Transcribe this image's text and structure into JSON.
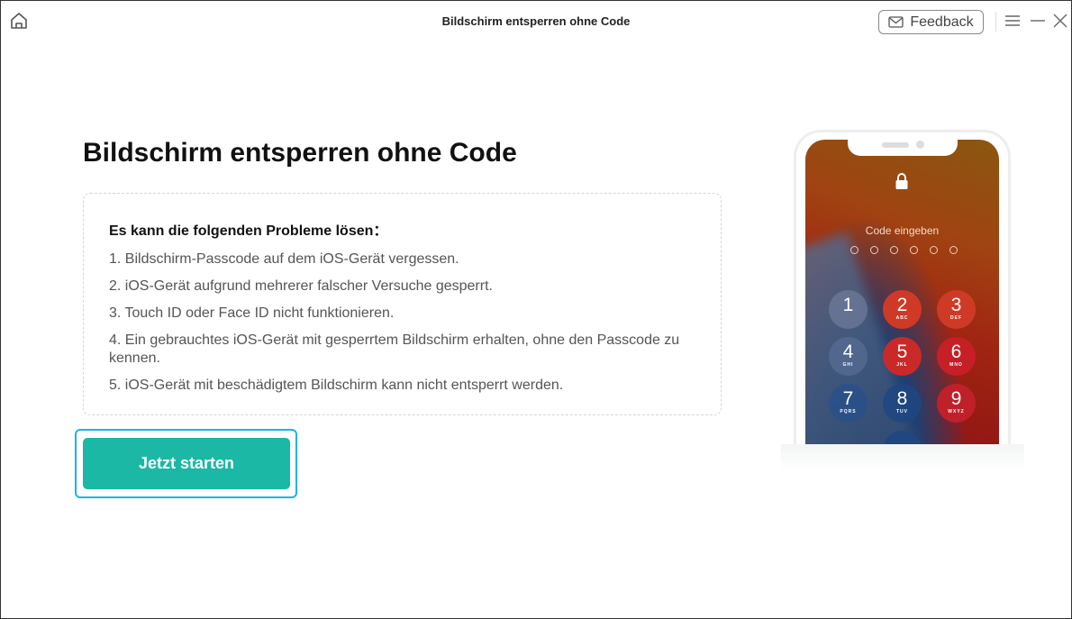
{
  "titlebar": {
    "title": "Bildschirm entsperren ohne Code",
    "feedback_label": "Feedback",
    "icons": [
      "home-icon",
      "mail-icon",
      "menu-icon",
      "minimize-icon",
      "close-icon"
    ]
  },
  "main": {
    "heading": "Bildschirm entsperren ohne Code",
    "box_title": "Es kann die folgenden Probleme lösen：",
    "items": [
      "1. Bildschirm-Passcode auf dem iOS-Gerät vergessen.",
      "2. iOS-Gerät aufgrund mehrerer falscher Versuche gesperrt.",
      "3. Touch ID oder Face ID nicht funktionieren.",
      "4. Ein gebrauchtes iOS-Gerät mit gesperrtem Bildschirm erhalten, ohne den Passcode zu kennen.",
      "5. iOS-Gerät mit beschädigtem Bildschirm kann nicht entsperrt werden."
    ],
    "start_button": "Jetzt starten",
    "accent": "#1ab8a5"
  },
  "phone": {
    "prompt": "Code eingeben",
    "keys": [
      {
        "d": "1",
        "l": ""
      },
      {
        "d": "2",
        "l": "ABC"
      },
      {
        "d": "3",
        "l": "DEF"
      },
      {
        "d": "4",
        "l": "GHI"
      },
      {
        "d": "5",
        "l": "JKL"
      },
      {
        "d": "6",
        "l": "MNO"
      },
      {
        "d": "7",
        "l": "PQRS"
      },
      {
        "d": "8",
        "l": "TUV"
      },
      {
        "d": "9",
        "l": "WXYZ"
      }
    ]
  }
}
